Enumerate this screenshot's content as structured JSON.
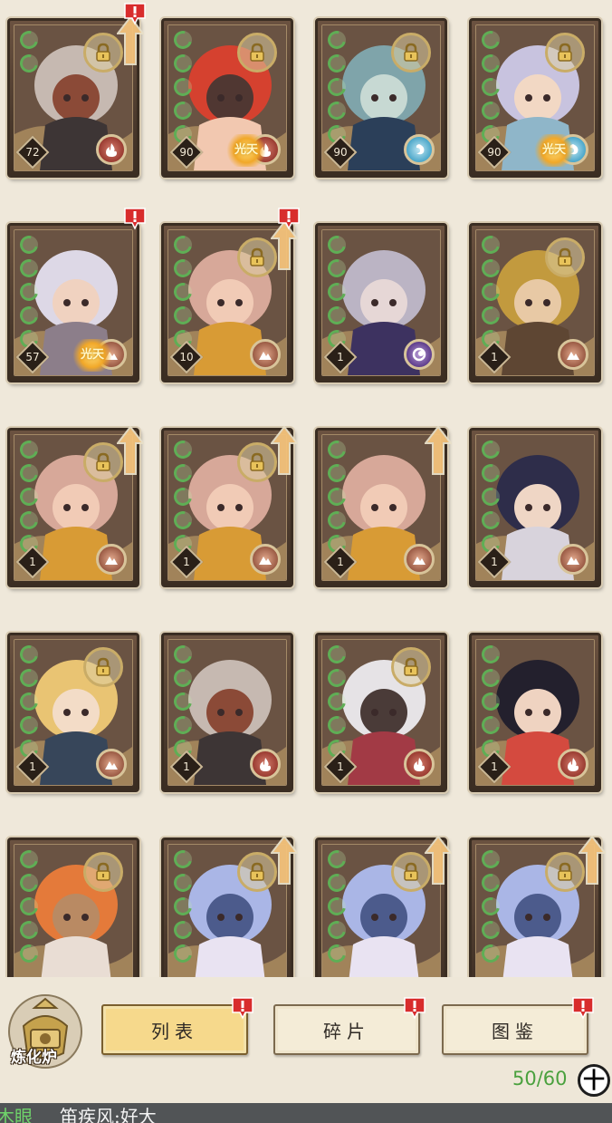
{
  "cards": [
    {
      "id": "c1",
      "level": "72",
      "element": "fire",
      "locked": true,
      "upgrade": true,
      "alert": true,
      "badge": "",
      "stars": 2,
      "palette": [
        "#c6b9b1",
        "#3d3535",
        "#8b4a37"
      ]
    },
    {
      "id": "c2",
      "level": "90",
      "element": "fire",
      "locked": true,
      "upgrade": false,
      "alert": false,
      "badge": "光天",
      "stars": 5,
      "palette": [
        "#d5412f",
        "#f2c8b0",
        "#503732"
      ]
    },
    {
      "id": "c3",
      "level": "90",
      "element": "water",
      "locked": true,
      "upgrade": false,
      "alert": false,
      "badge": "",
      "stars": 5,
      "palette": [
        "#7fa4aa",
        "#2b3f59",
        "#c7d9d3"
      ]
    },
    {
      "id": "c4",
      "level": "90",
      "element": "water",
      "locked": true,
      "upgrade": false,
      "alert": false,
      "badge": "光天",
      "stars": 5,
      "palette": [
        "#c8c3df",
        "#8fb6c9",
        "#f2d8c4"
      ]
    },
    {
      "id": "c5",
      "level": "57",
      "element": "earth",
      "locked": false,
      "upgrade": false,
      "alert": true,
      "badge": "光天",
      "stars": 5,
      "palette": [
        "#ddd8e6",
        "#8c7e8a",
        "#f0d2c0"
      ]
    },
    {
      "id": "c6",
      "level": "10",
      "element": "earth",
      "locked": true,
      "upgrade": true,
      "alert": true,
      "badge": "",
      "stars": 5,
      "palette": [
        "#d7a899",
        "#d89b35",
        "#f1cbb6"
      ]
    },
    {
      "id": "c7",
      "level": "1",
      "element": "dark",
      "locked": false,
      "upgrade": false,
      "alert": false,
      "badge": "",
      "stars": 5,
      "palette": [
        "#bbb4c4",
        "#3d3260",
        "#e6d7d6"
      ]
    },
    {
      "id": "c8",
      "level": "1",
      "element": "earth",
      "locked": true,
      "upgrade": false,
      "alert": false,
      "badge": "",
      "stars": 5,
      "palette": [
        "#c29a3e",
        "#5e4633",
        "#e8c9a5"
      ]
    },
    {
      "id": "c9",
      "level": "1",
      "element": "earth",
      "locked": true,
      "upgrade": true,
      "alert": false,
      "badge": "",
      "stars": 5,
      "palette": [
        "#d7a899",
        "#d89b35",
        "#f1cbb6"
      ]
    },
    {
      "id": "c10",
      "level": "1",
      "element": "earth",
      "locked": true,
      "upgrade": true,
      "alert": false,
      "badge": "",
      "stars": 5,
      "palette": [
        "#d7a899",
        "#d89b35",
        "#f1cbb6"
      ]
    },
    {
      "id": "c11",
      "level": "1",
      "element": "earth",
      "locked": false,
      "upgrade": true,
      "alert": false,
      "badge": "",
      "stars": 5,
      "palette": [
        "#d7a899",
        "#d89b35",
        "#f1cbb6"
      ]
    },
    {
      "id": "c12",
      "level": "1",
      "element": "earth",
      "locked": false,
      "upgrade": false,
      "alert": false,
      "badge": "",
      "stars": 5,
      "palette": [
        "#2e2d4a",
        "#d8d3dc",
        "#efd6c5"
      ]
    },
    {
      "id": "c13",
      "level": "1",
      "element": "earth",
      "locked": true,
      "upgrade": false,
      "alert": false,
      "badge": "",
      "stars": 5,
      "palette": [
        "#e9c473",
        "#37465a",
        "#f3dcc7"
      ]
    },
    {
      "id": "c14",
      "level": "1",
      "element": "fire",
      "locked": false,
      "upgrade": false,
      "alert": false,
      "badge": "",
      "stars": 5,
      "palette": [
        "#c6b9b1",
        "#3d3535",
        "#8b4a37"
      ]
    },
    {
      "id": "c15",
      "level": "1",
      "element": "fire",
      "locked": true,
      "upgrade": false,
      "alert": false,
      "badge": "",
      "stars": 5,
      "palette": [
        "#e6e3e6",
        "#a23a45",
        "#4a3b38"
      ]
    },
    {
      "id": "c16",
      "level": "1",
      "element": "fire",
      "locked": false,
      "upgrade": false,
      "alert": false,
      "badge": "",
      "stars": 5,
      "palette": [
        "#23202d",
        "#d44a3f",
        "#efd3c1"
      ]
    },
    {
      "id": "c17",
      "level": "",
      "element": "",
      "locked": true,
      "upgrade": false,
      "alert": false,
      "badge": "",
      "stars": 5,
      "palette": [
        "#e47a3a",
        "#e9ddd4",
        "#b98a63"
      ]
    },
    {
      "id": "c18",
      "level": "",
      "element": "",
      "locked": true,
      "upgrade": true,
      "alert": false,
      "badge": "",
      "stars": 5,
      "palette": [
        "#aab6e6",
        "#e9e3f2",
        "#4c5b8c"
      ]
    },
    {
      "id": "c19",
      "level": "",
      "element": "",
      "locked": true,
      "upgrade": true,
      "alert": false,
      "badge": "",
      "stars": 5,
      "palette": [
        "#aab6e6",
        "#e9e3f2",
        "#4c5b8c"
      ]
    },
    {
      "id": "c20",
      "level": "",
      "element": "",
      "locked": true,
      "upgrade": true,
      "alert": false,
      "badge": "",
      "stars": 5,
      "palette": [
        "#aab6e6",
        "#e9e3f2",
        "#4c5b8c"
      ]
    }
  ],
  "furnace": {
    "label": "炼化炉"
  },
  "tabs": [
    {
      "label": "列表",
      "active": true,
      "alert": true
    },
    {
      "label": "碎片",
      "active": false,
      "alert": true
    },
    {
      "label": "图鉴",
      "active": false,
      "alert": true
    }
  ],
  "capacity": {
    "text": "50/60"
  },
  "add_button": {
    "label": "十"
  },
  "ticker": {
    "name": "木眼",
    "text": "笛疾风:好大"
  },
  "colors": {
    "frame": "#3a2d22",
    "accent_gold": "#f6d98c",
    "alert_red": "#d82c2c",
    "capacity_green": "#4aa13e",
    "star_green": "#5fae55"
  }
}
